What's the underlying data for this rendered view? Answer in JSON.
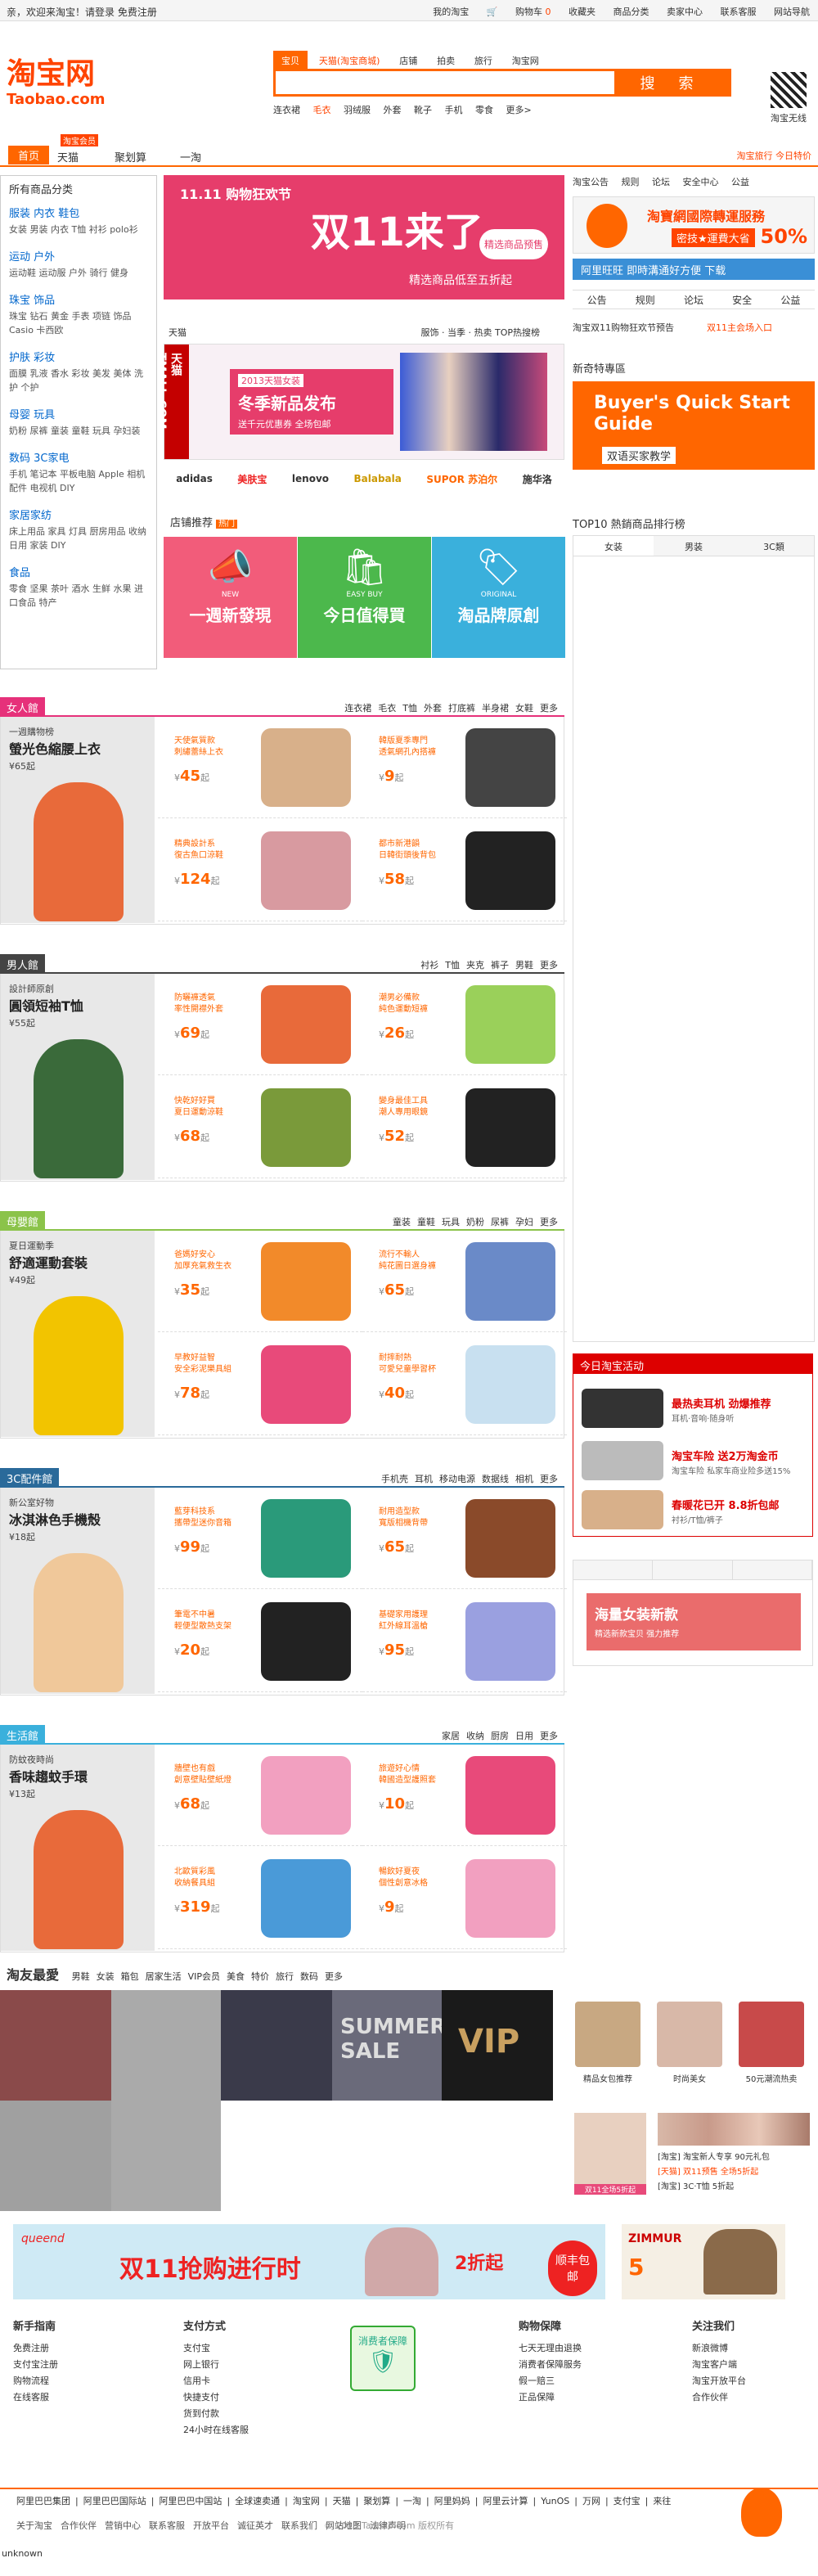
{
  "topbar": {
    "greeting": "亲，欢迎来淘宝！请登录 免费注册",
    "links": [
      "我的淘宝",
      "购物车",
      "收藏夹",
      "商品分类",
      "卖家中心",
      "联系客服",
      "网站导航"
    ],
    "cart_count": "0"
  },
  "logo": {
    "cn": "淘宝网",
    "en": "Taobao.com"
  },
  "search": {
    "tabs": [
      "宝贝",
      "天猫(淘宝商城)",
      "店铺",
      "拍卖",
      "旅行",
      "淘宝网"
    ],
    "placeholder": "",
    "button": "搜 索",
    "hot": [
      "连衣裙",
      "毛衣",
      "羽绒服",
      "外套",
      "靴子",
      "手机",
      "零食",
      "更多>"
    ]
  },
  "qr": "淘宝无线",
  "nav": {
    "items": [
      "首页",
      "天猫",
      "聚划算",
      "一淘"
    ],
    "badge": "淘宝会员",
    "promo": "淘宝旅行 今日特价"
  },
  "sidebar": {
    "title": "所有商品分类",
    "categories": [
      {
        "title": "服装 内衣 鞋包",
        "items": "女装 男装 内衣 T恤 衬衫 polo衫"
      },
      {
        "title": "运动 户外",
        "items": "运动鞋 运动服 户外 骑行 健身"
      },
      {
        "title": "珠宝 饰品",
        "items": "珠宝 钻石 黄金 手表 项链 饰品 Casio 卡西欧"
      },
      {
        "title": "护肤 彩妆",
        "items": "面膜 乳液 香水 彩妆 美发 美体 洗护 个护"
      },
      {
        "title": "母婴 玩具",
        "items": "奶粉 尿裤 童装 童鞋 玩具 孕妇装"
      },
      {
        "title": "数码 3C家电",
        "items": "手机 笔记本 平板电脑 Apple 相机 配件 电视机 DIY"
      },
      {
        "title": "家居家纺",
        "items": "床上用品 家具 灯具 厨房用品 收纳 日用 家装 DIY"
      },
      {
        "title": "食品",
        "items": "零食 坚果 茶叶 酒水 生鲜 水果 进口食品 特产"
      }
    ]
  },
  "banner1": {
    "logo": "11.11 购物狂欢节",
    "big": "双11来了",
    "sub": "精选商品低至五折起",
    "badge": "精选商品预售"
  },
  "tmall": {
    "hdr_left": "天猫",
    "hdr_right": "服饰 · 当季 · 热卖 TOP热搜榜",
    "side": "天猫 TMALL.COM",
    "tag": "2013天猫女装",
    "title": "冬季新品发布",
    "sub": "送千元优惠券 全场包邮"
  },
  "brands": [
    "adidas",
    "美肤宝",
    "lenovo",
    "Balabala",
    "SUPOR 苏泊尔",
    "施华洛"
  ],
  "shop": {
    "title": "店铺推荐",
    "badge": "热门",
    "tiles": [
      {
        "text": "一週新發現",
        "sub": "NEW",
        "color": "#f25c7a"
      },
      {
        "text": "今日值得買",
        "sub": "EASY BUY",
        "color": "#4cb84c"
      },
      {
        "text": "淘品牌原創",
        "sub": "ORIGINAL",
        "color": "#3ab0dc"
      }
    ]
  },
  "right": {
    "top_links": [
      "淘宝公告",
      "规则",
      "论坛",
      "安全中心",
      "公益"
    ],
    "banner": {
      "t1": "淘寶網國際轉運服務",
      "t2": "密技★運費大省",
      "pct": "50%"
    },
    "ali": "阿里旺旺 即時溝通好方便 下载",
    "tabs": [
      "公告",
      "规则",
      "论坛",
      "安全",
      "公益"
    ],
    "msg_left": "淘宝双11购物狂欢节预告",
    "msg_right": "双11主会场入口",
    "special_title": "新奇特專區",
    "special": {
      "t1": "Buyer's Quick Start Guide",
      "t2": "双语买家教学"
    },
    "top10": "TOP10 熱銷商品排行榜",
    "top10_tabs": [
      "女装",
      "男装",
      "3C類"
    ]
  },
  "sections": [
    {
      "name": "女人館",
      "color": "#e6317a",
      "links": [
        "连衣裙",
        "毛衣",
        "T恤",
        "外套",
        "打底裤",
        "半身裙",
        "女鞋",
        "更多"
      ],
      "feat": {
        "l1": "一週購物榜",
        "l2": "螢光色縮腰上衣",
        "l3": "¥65起",
        "color": "#e86a3a"
      },
      "prods": [
        {
          "d1": "天使氣質款",
          "d2": "刺繡蕾絲上衣",
          "price": "45",
          "color": "#d8b08a"
        },
        {
          "d1": "韓版夏季專門",
          "d2": "透氣網孔內搭褲",
          "price": "9",
          "color": "#444"
        },
        {
          "d1": "精典設計系",
          "d2": "復古魚口涼鞋",
          "price": "124",
          "color": "#d89aa0"
        },
        {
          "d1": "都市新港韻",
          "d2": "日韓街頭後背包",
          "price": "58",
          "color": "#222"
        }
      ]
    },
    {
      "name": "男人館",
      "color": "#444",
      "links": [
        "衬衫",
        "T恤",
        "夹克",
        "裤子",
        "男鞋",
        "更多"
      ],
      "feat": {
        "l1": "設計師原創",
        "l2": "圓領短袖T恤",
        "l3": "¥55起",
        "color": "#3a6a3a"
      },
      "prods": [
        {
          "d1": "防曬褲透氣",
          "d2": "率性開襟外套",
          "price": "69",
          "color": "#e86a3a"
        },
        {
          "d1": "潮男必備款",
          "d2": "純色運動短褲",
          "price": "26",
          "color": "#9ad05a"
        },
        {
          "d1": "快乾好好買",
          "d2": "夏日運動涼鞋",
          "price": "68",
          "color": "#7a9a3a"
        },
        {
          "d1": "變身最佳工具",
          "d2": "潮人專用眼鏡",
          "price": "52",
          "color": "#222"
        }
      ]
    },
    {
      "name": "母嬰館",
      "color": "#8bc34a",
      "links": [
        "童装",
        "童鞋",
        "玩具",
        "奶粉",
        "尿裤",
        "孕妇",
        "更多"
      ],
      "feat": {
        "l1": "夏日運動季",
        "l2": "舒適運動套裝",
        "l3": "¥49起",
        "color": "#f2c400"
      },
      "prods": [
        {
          "d1": "爸媽好安心",
          "d2": "加厚充氣救生衣",
          "price": "35",
          "color": "#f28a2a"
        },
        {
          "d1": "流行不輸人",
          "d2": "純花圖日選身褲",
          "price": "65",
          "color": "#6a8ac8"
        },
        {
          "d1": "早教好益智",
          "d2": "安全彩泥樂具組",
          "price": "78",
          "color": "#e84a7a"
        },
        {
          "d1": "耐摔耐熱",
          "d2": "可愛兒童學習杯",
          "price": "40",
          "color": "#c8e0f0"
        }
      ]
    },
    {
      "name": "3C配件館",
      "color": "#2a6a9a",
      "links": [
        "手机壳",
        "耳机",
        "移动电源",
        "数据线",
        "相机",
        "更多"
      ],
      "feat": {
        "l1": "新公室好物",
        "l2": "冰淇淋色手機殼",
        "l3": "¥18起",
        "color": "#f0c89a"
      },
      "prods": [
        {
          "d1": "藍芽科技系",
          "d2": "攜帶型迷你音箱",
          "price": "99",
          "color": "#2a9a7a"
        },
        {
          "d1": "耐用造型款",
          "d2": "寬版相機背帶",
          "price": "65",
          "color": "#8a4a2a"
        },
        {
          "d1": "筆電不中暑",
          "d2": "輕便型散熱支架",
          "price": "20",
          "color": "#222"
        },
        {
          "d1": "基礎家用護理",
          "d2": "紅外線耳溫槍",
          "price": "95",
          "color": "#9aa0e0"
        }
      ]
    },
    {
      "name": "生活館",
      "color": "#3ab0dc",
      "links": [
        "家居",
        "收纳",
        "厨房",
        "日用",
        "更多"
      ],
      "feat": {
        "l1": "防蚊夜時尚",
        "l2": "香味趨蚊手環",
        "l3": "¥13起",
        "color": "#e86a3a"
      },
      "prods": [
        {
          "d1": "牆壁也有戲",
          "d2": "創意壁貼壁紙燈",
          "price": "68",
          "color": "#f2a0c0"
        },
        {
          "d1": "旅遊好心情",
          "d2": "韓國造型護照套",
          "price": "10",
          "color": "#e84a7a"
        },
        {
          "d1": "北歐質彩風",
          "d2": "收納餐具組",
          "price": "319",
          "color": "#4a9ad8"
        },
        {
          "d1": "暢飲好夏夜",
          "d2": "個性創意冰格",
          "price": "9",
          "color": "#f2a0c0"
        }
      ]
    }
  ],
  "fav": {
    "title": "淘友最愛",
    "links": [
      "男鞋",
      "女装",
      "箱包",
      "居家生活",
      "VIP会员",
      "美食",
      "特价",
      "旅行",
      "数码",
      "更多"
    ],
    "right_items": [
      "精品女包推荐",
      "时尚美女",
      "50元潮流热卖"
    ],
    "bottom_items": [
      "[淘宝] 淘宝新人专享 90元礼包",
      "[天猫] 双11预售 全场5折起",
      "[淘宝] 3C·T恤 5折起"
    ],
    "bottom_badge": "双11全场5折起"
  },
  "ads": {
    "brand": "queend",
    "big": "双11抢购进行时",
    "off": "2折起",
    "btn": "顺丰包邮",
    "b2": "ZIMMUR",
    "b2num": "5"
  },
  "today": {
    "title": "今日淘宝活动",
    "rows": [
      {
        "t1": "最热卖耳机 劲爆推荐",
        "t2": "耳机·音响·随身听",
        "color": "#333"
      },
      {
        "t1": "淘宝车险 送2万淘金币",
        "t2": "淘宝车险 私家车商业险多送15%",
        "color": "#bbb"
      },
      {
        "t1": "春暖花已开 8.8折包邮",
        "t2": "衬衫/T恤/裤子",
        "color": "#d8b08a"
      }
    ]
  },
  "women_ad": {
    "t1": "海量女装新款",
    "t2": "精选新款宝贝 强力推荐"
  },
  "footer": {
    "cols": [
      {
        "h": "新手指南",
        "items": [
          "免费注册",
          "支付宝注册",
          "购物流程",
          "在线客服"
        ]
      },
      {
        "h": "支付方式",
        "items": [
          "支付宝",
          "网上银行",
          "信用卡",
          "快捷支付",
          "货到付款",
          "24小时在线客服"
        ]
      },
      {
        "h": "购物保障",
        "items": [
          "七天无理由退换",
          "消费者保障服务",
          "假一赔三",
          "正品保障"
        ]
      },
      {
        "h": "关注我们",
        "items": [
          "新浪微博",
          "淘宝客户端",
          "淘宝开放平台",
          "合作伙伴"
        ]
      }
    ],
    "guarantee": "消费者保障",
    "links1": [
      "阿里巴巴集团",
      "阿里巴巴国际站",
      "阿里巴巴中国站",
      "全球速卖通",
      "淘宝网",
      "天猫",
      "聚划算",
      "一淘",
      "阿里妈妈",
      "阿里云计算",
      "YunOS",
      "万网",
      "支付宝",
      "来往"
    ],
    "links2": [
      "关于淘宝",
      "合作伙伴",
      "营销中心",
      "联系客服",
      "开放平台",
      "诚征英才",
      "联系我们",
      "网站地图",
      "法律声明"
    ],
    "copy": "© 2013 Taobao.com 版权所有",
    "unknown": "unknown"
  }
}
